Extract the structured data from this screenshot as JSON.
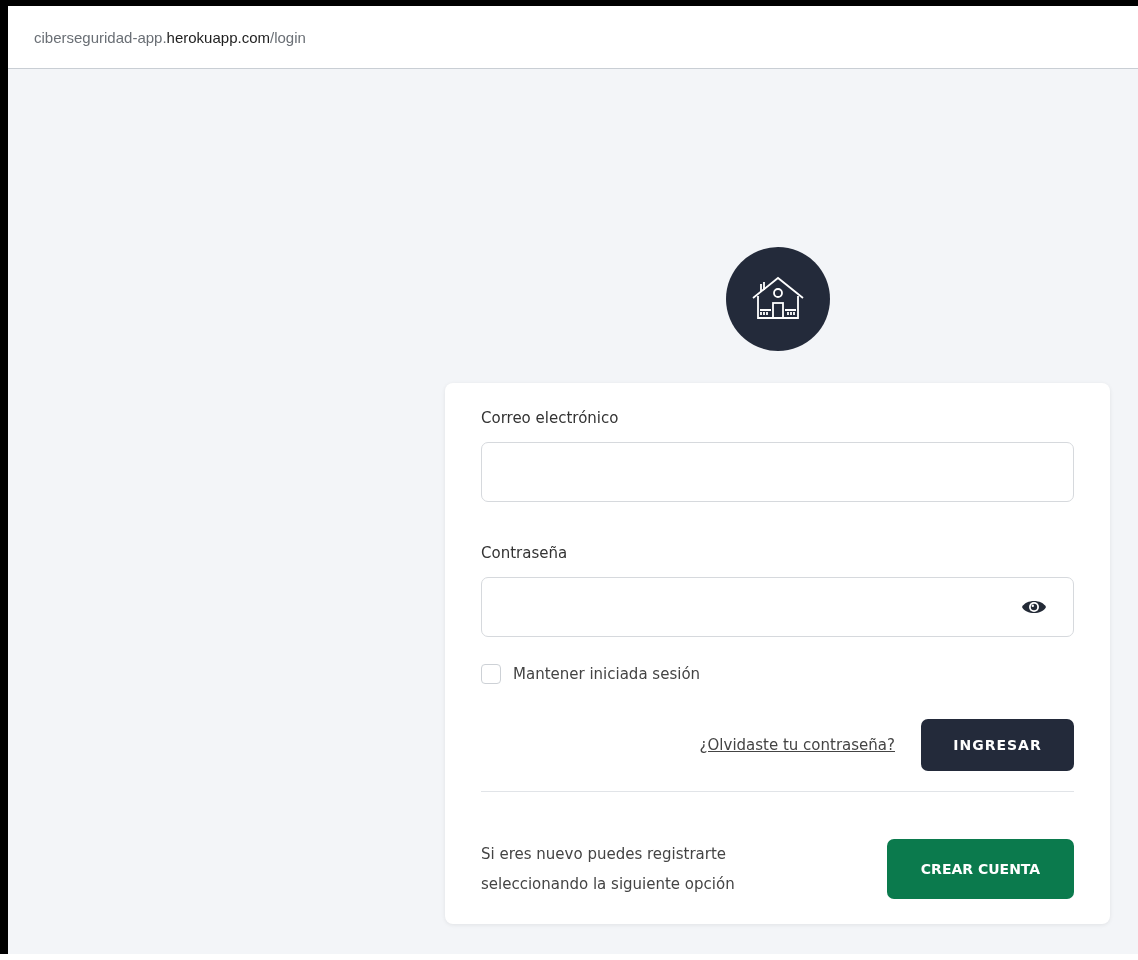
{
  "address_bar": {
    "url": "ciberseguridad-app.**herokuapp.com**/login"
  },
  "login_form": {
    "fields": [
      {
        "kind": "email",
        "label": "Correo electrónico"
      },
      {
        "kind": "password",
        "label": "Contraseña"
      }
    ],
    "remember": {
      "label": "Mantener iniciada sesión",
      "checked": false
    },
    "forgot_link": "¿Olvidaste tu contraseña?",
    "submit_button": "INGRESAR",
    "register_text": "Si eres nuevo puedes registrarte seleccionando la siguiente opción",
    "register_button": "CREAR CUENTA"
  }
}
